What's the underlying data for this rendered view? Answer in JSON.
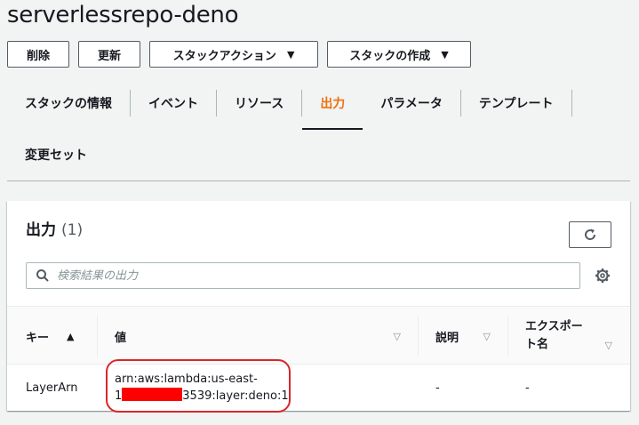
{
  "page": {
    "title": "serverlessrepo-deno"
  },
  "actions": {
    "delete_label": "削除",
    "update_label": "更新",
    "stack_actions_label": "スタックアクション",
    "create_stack_label": "スタックの作成"
  },
  "tabs": {
    "items": [
      {
        "label": "スタックの情報"
      },
      {
        "label": "イベント"
      },
      {
        "label": "リソース"
      },
      {
        "label": "出力",
        "active": true
      },
      {
        "label": "パラメータ"
      },
      {
        "label": "テンプレート"
      },
      {
        "label": "変更セット"
      }
    ]
  },
  "outputs": {
    "title": "出力",
    "count": "(1)",
    "search_placeholder": "検索結果の出力",
    "columns": {
      "key": "キー",
      "value": "値",
      "description": "説明",
      "export_line1": "エクスポー",
      "export_line2": "ト名"
    },
    "rows": [
      {
        "key": "LayerArn",
        "value_line1": "arn:aws:lambda:us-east-",
        "value_prefix": "1",
        "value_suffix": "3539:layer:deno:1",
        "description": "-",
        "export_name": "-"
      }
    ]
  },
  "colors": {
    "accent": "#ec7211",
    "annotation": "#d9262a",
    "redaction": "#ff0000"
  },
  "icons": [
    "refresh-icon",
    "search-icon",
    "gear-icon",
    "caret-down-icon",
    "sort-ascending-icon",
    "sort-descending-icon"
  ]
}
